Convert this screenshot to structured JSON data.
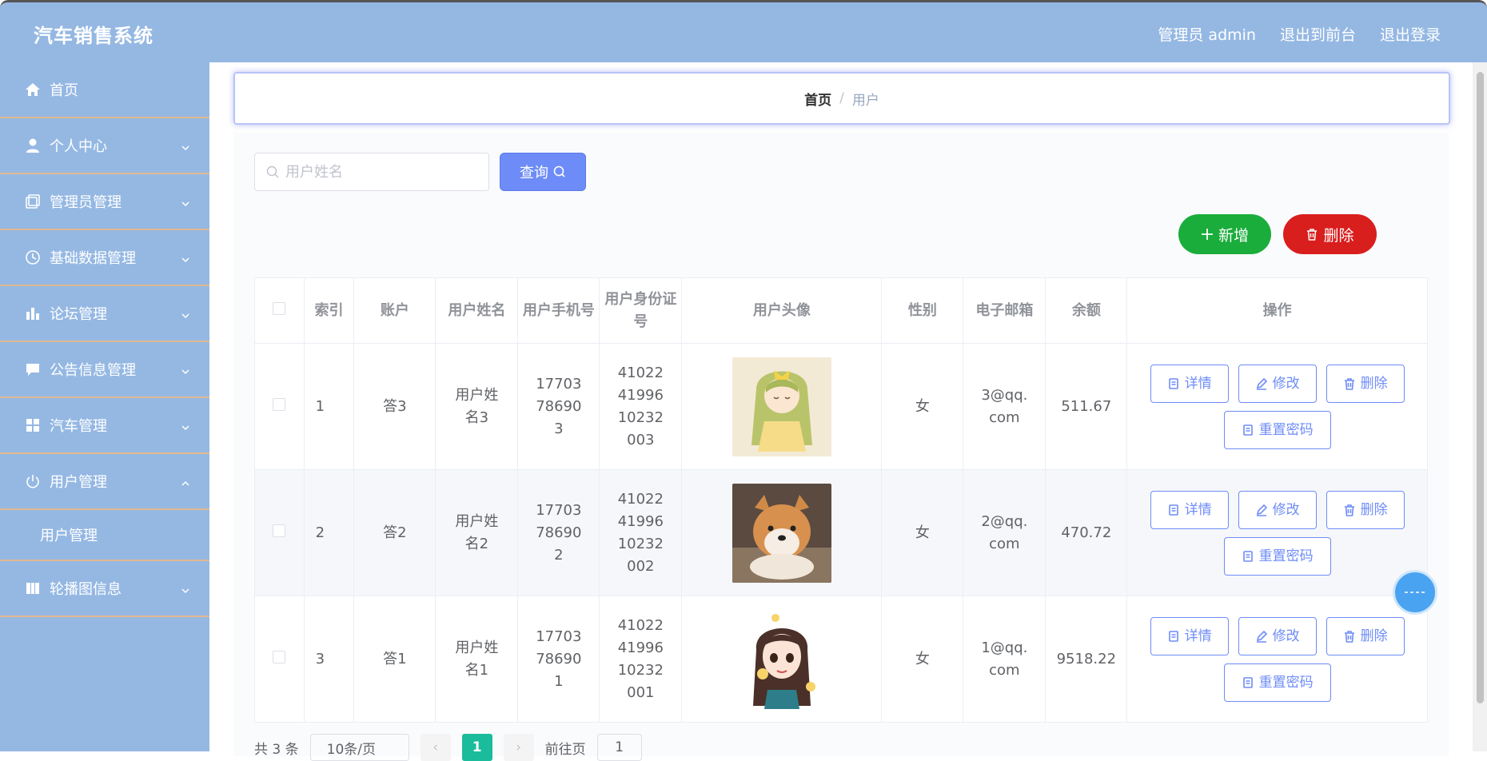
{
  "header": {
    "title": "汽车销售系统",
    "admin_label": "管理员 admin",
    "front_label": "退出到前台",
    "logout_label": "退出登录"
  },
  "sidebar": {
    "items": [
      {
        "label": "首页",
        "icon": "home-icon"
      },
      {
        "label": "个人中心",
        "icon": "user-icon"
      },
      {
        "label": "管理员管理",
        "icon": "copy-icon"
      },
      {
        "label": "基础数据管理",
        "icon": "clock-icon"
      },
      {
        "label": "论坛管理",
        "icon": "bar-chart-icon"
      },
      {
        "label": "公告信息管理",
        "icon": "message-icon"
      },
      {
        "label": "汽车管理",
        "icon": "grid-icon"
      },
      {
        "label": "用户管理",
        "icon": "power-icon",
        "sub": "用户管理"
      },
      {
        "label": "轮播图信息",
        "icon": "tag-icon"
      }
    ]
  },
  "breadcrumb": {
    "home": "首页",
    "sep": "/",
    "current": "用户"
  },
  "search": {
    "placeholder": "用户姓名",
    "query_label": "查询"
  },
  "actions": {
    "add_label": "新增",
    "delete_label": "删除"
  },
  "table": {
    "headers": [
      "索引",
      "账户",
      "用户姓名",
      "用户手机号",
      "用户身份证号",
      "用户头像",
      "性别",
      "电子邮箱",
      "余额",
      "操作"
    ],
    "rows": [
      {
        "index": "1",
        "account": "答3",
        "name": "用户姓名3",
        "phone": "17703786903",
        "id_card": "410224199610232003",
        "gender": "女",
        "email": "3@qq.com",
        "balance": "511.67"
      },
      {
        "index": "2",
        "account": "答2",
        "name": "用户姓名2",
        "phone": "17703786902",
        "id_card": "410224199610232002",
        "gender": "女",
        "email": "2@qq.com",
        "balance": "470.72"
      },
      {
        "index": "3",
        "account": "答1",
        "name": "用户姓名1",
        "phone": "17703786901",
        "id_card": "410224199610232001",
        "gender": "女",
        "email": "1@qq.com",
        "balance": "9518.22"
      }
    ],
    "ops": {
      "detail": "详情",
      "edit": "修改",
      "delete": "删除",
      "reset": "重置密码"
    }
  },
  "pager": {
    "total": "共 3 条",
    "size": "10条/页",
    "page": "1",
    "goto": "前往页",
    "goto_value": "1"
  },
  "colors": {
    "header_bg": "#95b8e3",
    "accent": "#6e8cf7",
    "add": "#1aad3b",
    "danger": "#d91e1e",
    "pager_active": "#1abc9c"
  }
}
